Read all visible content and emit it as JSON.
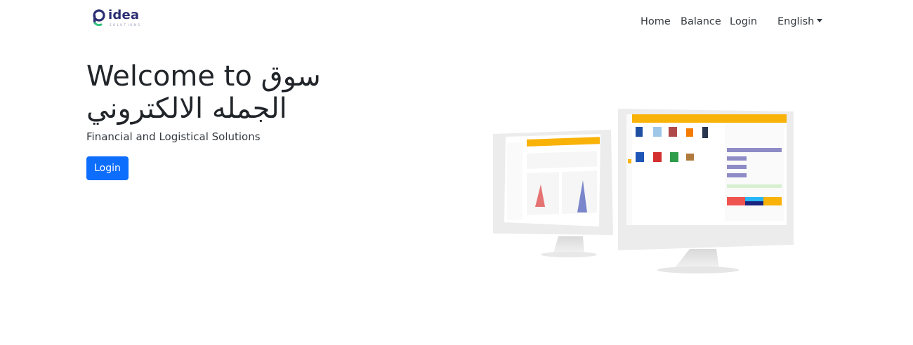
{
  "nav": {
    "brand": "idea",
    "brand_tagline": "SOLUTIONS",
    "links": [
      "Home",
      "Balance",
      "Login"
    ],
    "language": "English"
  },
  "hero": {
    "title": "Welcome to سوق الجمله الالكتروني",
    "subtitle": "Financial and Logistical Solutions",
    "login_button": "Login"
  },
  "colors": {
    "accent": "#0d6efd",
    "brand": "#2c2f72",
    "brand_green": "#2ec27e",
    "dashboard_yellow": "#f9b208"
  },
  "illustration": {
    "icon": "dual-monitor-dashboard-illustration"
  }
}
